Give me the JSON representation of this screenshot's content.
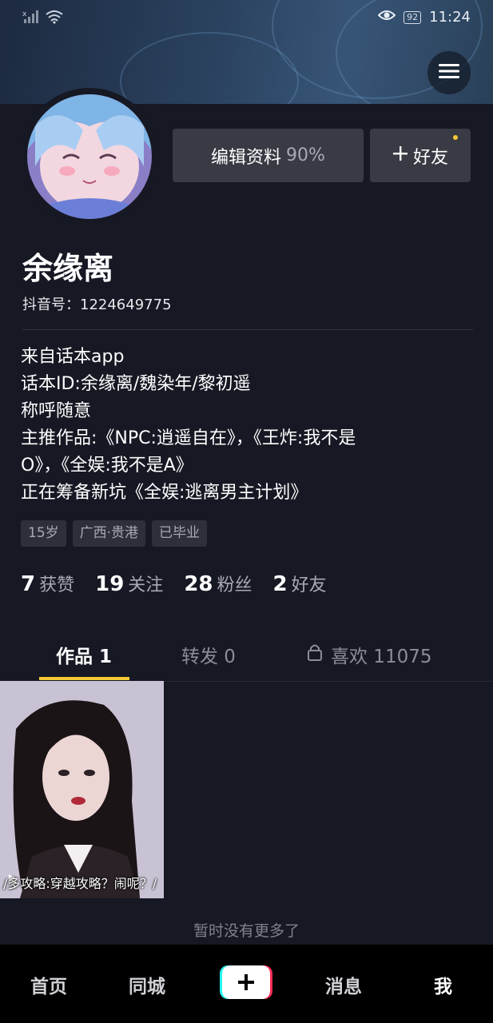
{
  "status_bar": {
    "battery": "92",
    "time": "11:24"
  },
  "profile": {
    "name": "余缘离",
    "douyin_id": "抖音号：1224649775",
    "edit_label": "编辑资料",
    "edit_progress": "90%",
    "add_friend_label": "好友",
    "bio": [
      "来自话本app",
      "话本ID:余缘离/魏染年/黎初遥",
      "称呼随意",
      "主推作品:《NPC:逍遥自在》，《王炸:我不是",
      "O》，《全娱:我不是A》",
      "正在筹备新坑《全娱:逃离男主计划》"
    ],
    "tags": [
      "15岁",
      "广西·贵港",
      "已毕业"
    ]
  },
  "stats": [
    {
      "num": "7",
      "label": "获赞"
    },
    {
      "num": "19",
      "label": "关注"
    },
    {
      "num": "28",
      "label": "粉丝"
    },
    {
      "num": "2",
      "label": "好友"
    }
  ],
  "tabs": [
    {
      "label": "作品 1"
    },
    {
      "label": "转发 0"
    },
    {
      "label": "喜欢 11075"
    }
  ],
  "video": {
    "caption": "/多攻略:穿越攻略？闹呢？/"
  },
  "no_more": "暂时没有更多了",
  "nav": {
    "home": "首页",
    "nearby": "同城",
    "messages": "消息",
    "me": "我"
  }
}
